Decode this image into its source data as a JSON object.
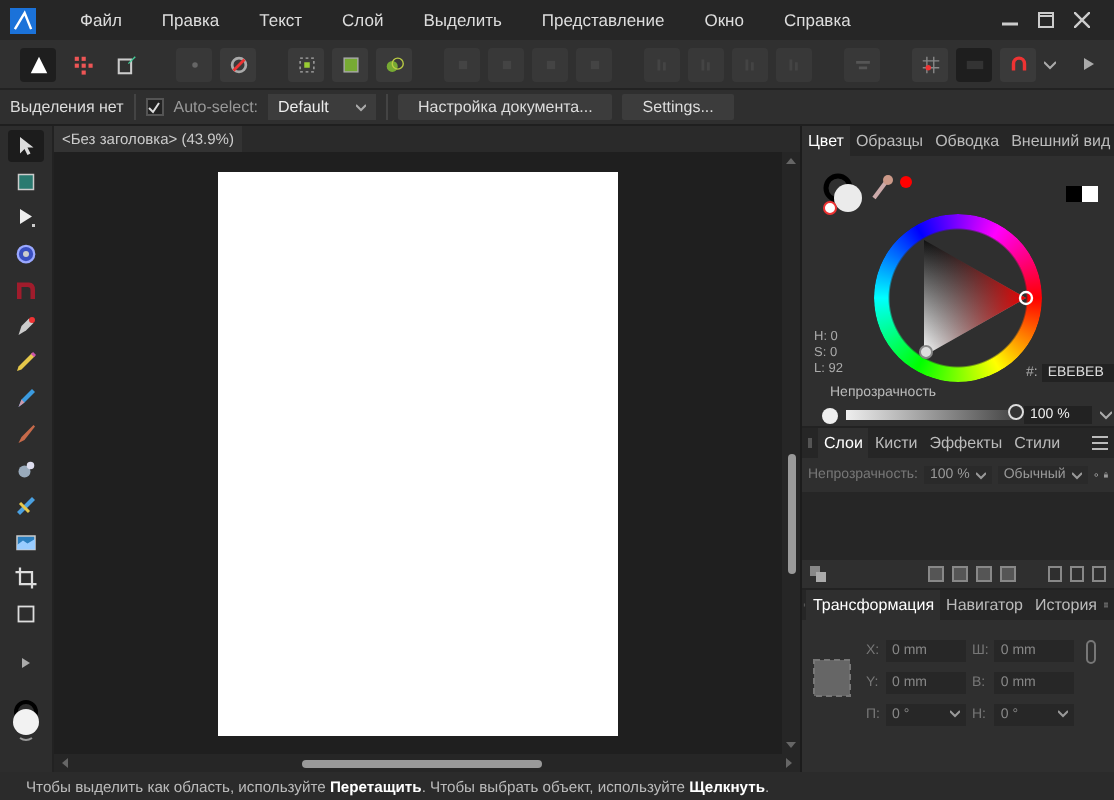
{
  "menu": [
    "Файл",
    "Правка",
    "Текст",
    "Слой",
    "Выделить",
    "Представление",
    "Окно",
    "Справка"
  ],
  "personas": [
    {
      "selected": true
    },
    {
      "selected": false
    },
    {
      "selected": false
    }
  ],
  "context_bar": {
    "selection": "Выделения нет",
    "auto_select": {
      "label": "Auto-select:",
      "checked": true
    },
    "mode": "Default",
    "buttons": [
      "Настройка документа...",
      "Settings..."
    ]
  },
  "tools": [
    {
      "selected": true
    },
    {
      "selected": false
    },
    {
      "selected": false
    },
    {
      "selected": false
    },
    {
      "selected": false
    },
    {
      "selected": false
    },
    {
      "selected": false
    },
    {
      "selected": false
    },
    {
      "selected": false
    },
    {
      "selected": false
    },
    {
      "selected": false
    },
    {
      "selected": false
    },
    {
      "selected": false
    },
    {
      "selected": false
    }
  ],
  "document": {
    "title": "<Без заголовка> (43.9%)"
  },
  "color_panel": {
    "tabs": [
      {
        "label": "Цвет",
        "selected": true
      },
      {
        "label": "Образцы",
        "selected": false
      },
      {
        "label": "Обводка",
        "selected": false
      },
      {
        "label": "Внешний вид",
        "selected": false
      }
    ],
    "readouts": [
      "H: 0",
      "S: 0",
      "L: 92"
    ],
    "hex_label": "#:",
    "hex": "EBEBEB",
    "opacity_label": "Непрозрачность",
    "opacity": {
      "level": 1.0,
      "value": "100 %"
    }
  },
  "layers_panel": {
    "tabs": [
      {
        "label": "Слои",
        "selected": true
      },
      {
        "label": "Кисти",
        "selected": false
      },
      {
        "label": "Эффекты",
        "selected": false
      },
      {
        "label": "Стили",
        "selected": false
      }
    ],
    "opacity_label": "Непрозрачность:",
    "opacity": "100 %",
    "blend": "Обычный"
  },
  "transform_panel": {
    "tabs": [
      {
        "label": "Трансформация",
        "selected": true
      },
      {
        "label": "Навигатор",
        "selected": false
      },
      {
        "label": "История",
        "selected": false
      }
    ],
    "fields": [
      {
        "label": "X:",
        "value": "0 mm"
      },
      {
        "label": "Ш:",
        "value": "0 mm"
      },
      {
        "label": "Y:",
        "value": "0 mm"
      },
      {
        "label": "В:",
        "value": "0 mm"
      },
      {
        "label": "П:",
        "value": "0 °",
        "kind": "dropdown"
      },
      {
        "label": "Н:",
        "value": "0 °",
        "kind": "dropdown"
      }
    ]
  },
  "status_bar": "Чтобы выделить как область, используйте **Перетащить**. Чтобы выбрать объект, используйте **Щелкнуть**."
}
